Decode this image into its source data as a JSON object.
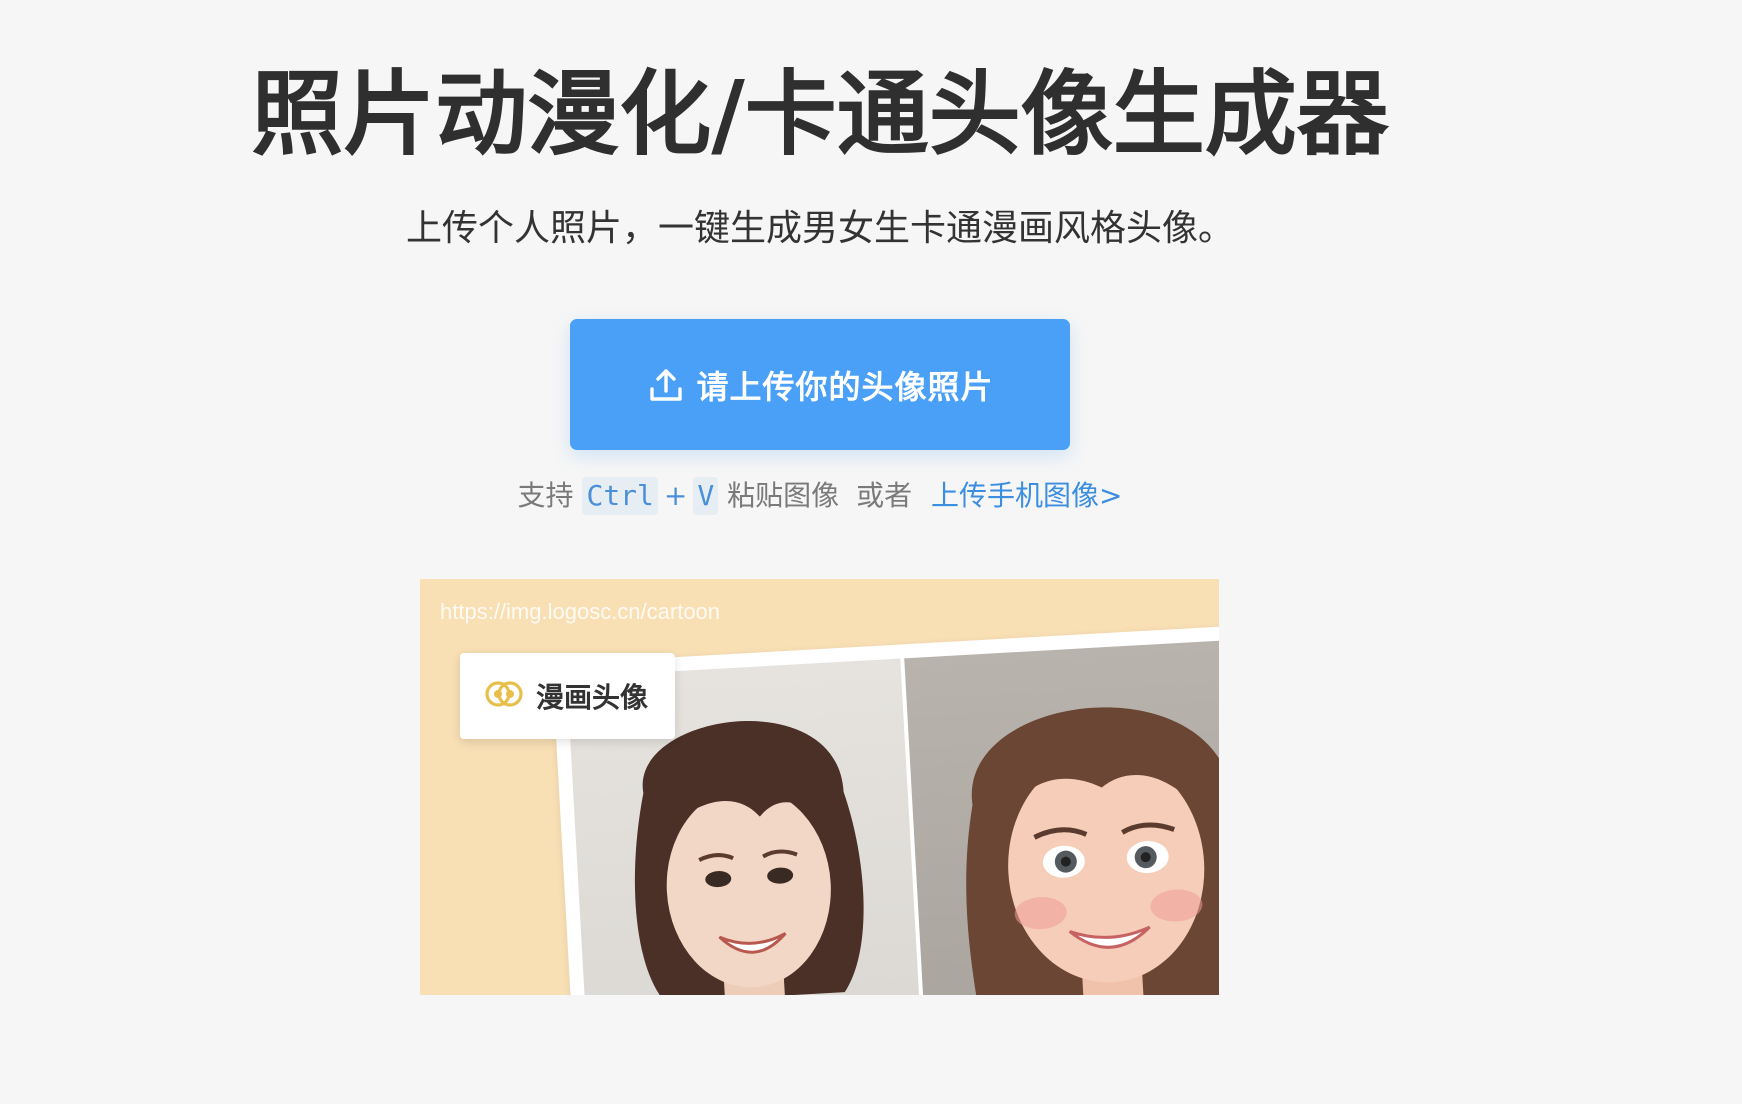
{
  "header": {
    "title": "照片动漫化/卡通头像生成器",
    "subtitle": "上传个人照片，一键生成男女生卡通漫画风格头像。"
  },
  "upload": {
    "button_label": "请上传你的头像照片",
    "icon": "upload-icon"
  },
  "hint": {
    "prefix": "支持",
    "key1": "Ctrl",
    "plus": "+",
    "key2": "V",
    "suffix": "粘贴图像",
    "or": "或者",
    "mobile_link": "上传手机图像>"
  },
  "preview": {
    "url_watermark": "https://img.logosc.cn/cartoon",
    "badge_label": "漫画头像",
    "badge_icon": "brand-logo-icon"
  },
  "colors": {
    "background": "#f6f6f6",
    "primary": "#4aa0f6",
    "link": "#3c8fe0",
    "preview_bg": "#f8dfb4"
  }
}
